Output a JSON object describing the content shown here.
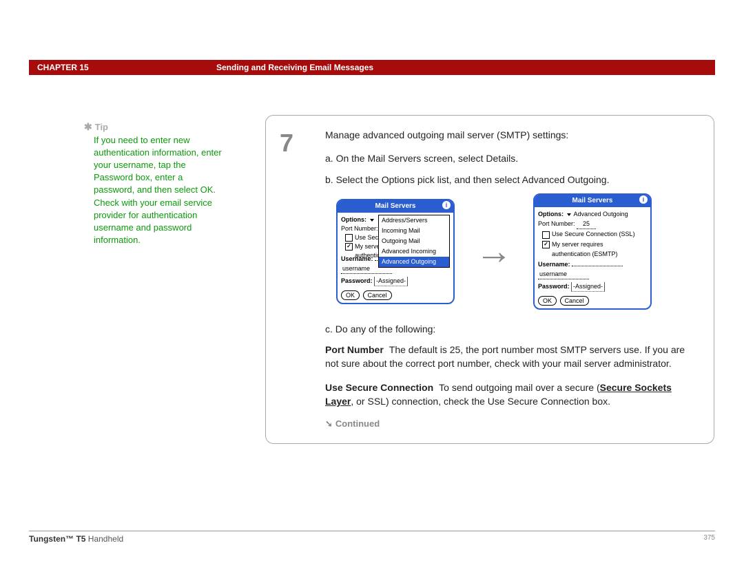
{
  "header": {
    "chapter": "CHAPTER 15",
    "title": "Sending and Receiving Email Messages"
  },
  "tip": {
    "label": "Tip",
    "body": "If you need to enter new authentication information, enter your username, tap the Password box, enter a password, and then select OK. Check with your email service provider for authentication username and password information."
  },
  "step": {
    "number": "7",
    "intro": "Manage advanced outgoing mail server (SMTP) settings:",
    "a": "a.  On the Mail Servers screen, select Details.",
    "b": "b.  Select the Options pick list, and then select Advanced Outgoing.",
    "c": "c.  Do any of the following:",
    "port": {
      "term": "Port Number",
      "text": "The default is 25, the port number most SMTP servers use. If you are not sure about the correct port number, check with your mail server administrator."
    },
    "ssl": {
      "term": "Use Secure Connection",
      "text_pre": "To send outgoing mail over a secure (",
      "term2": "Secure Sockets Layer",
      "text_post": ", or SSL) connection, check the Use Secure Connection box."
    },
    "continued": "Continued"
  },
  "screen1": {
    "title": "Mail Servers",
    "options": "Options:",
    "portnum": "Port Number:",
    "menu": {
      "m0": "Address/Servers",
      "m1": "Incoming Mail",
      "m2": "Outgoing Mail",
      "m3": "Advanced Incoming",
      "m4": "Advanced Outgoing"
    },
    "use_sec": "Use  Secu",
    "my_serve": "My serve",
    "auth_es": "authentication (ESMTP)",
    "username_l": "Username:",
    "username_v": "username",
    "password_l": "Password:",
    "assigned": "-Assigned-",
    "ok": "OK",
    "cancel": "Cancel"
  },
  "screen2": {
    "title": "Mail Servers",
    "options": "Options:",
    "opt_val": "Advanced Outgoing",
    "portnum": "Port Number:",
    "port_val": "25",
    "use_sec": "Use  Secure Connection (SSL)",
    "my_serv": "My server requires",
    "auth_es": "authentication (ESMTP)",
    "username_l": "Username:",
    "username_v": "username",
    "password_l": "Password:",
    "assigned": "-Assigned-",
    "ok": "OK",
    "cancel": "Cancel"
  },
  "footer": {
    "product_bold": "Tungsten™ T5",
    "product_rest": " Handheld",
    "page": "375"
  }
}
